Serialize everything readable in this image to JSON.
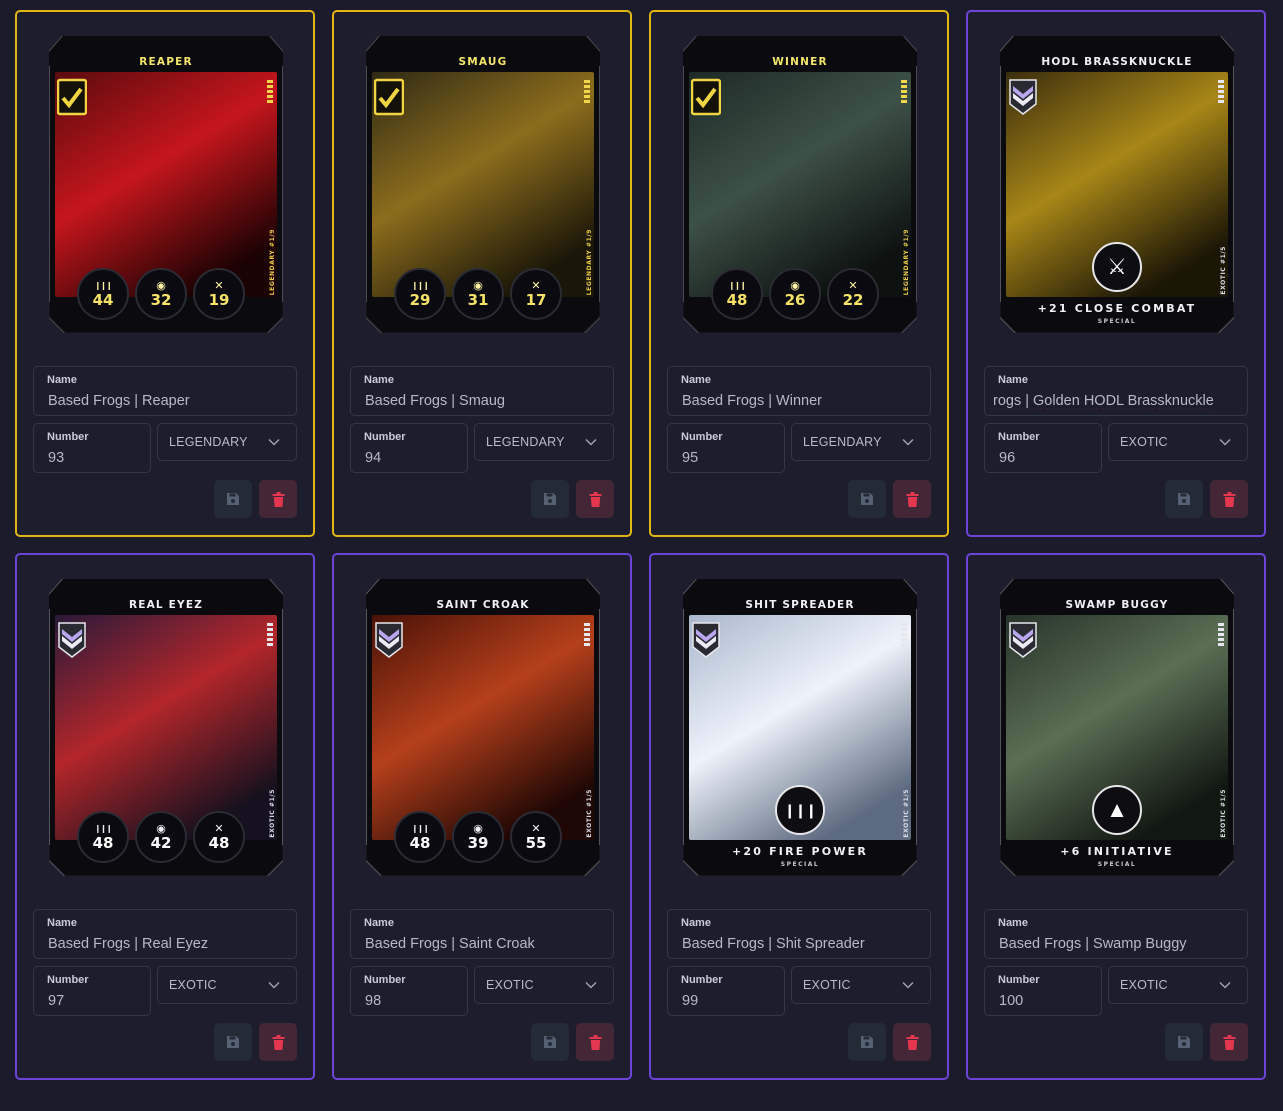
{
  "form": {
    "name_label": "Name",
    "number_label": "Number"
  },
  "colors": {
    "legendary": "#e2b613",
    "exotic": "#6c45d8",
    "save_icon": "#556273",
    "delete_icon": "#e5364f"
  },
  "icons": {
    "save": "floppy-disk-icon",
    "delete": "trash-icon",
    "dropdown": "chevron-down-icon"
  },
  "cards": [
    {
      "title": "REAPER",
      "rarity": "LEGENDARY",
      "name": "Based Frogs | Reaper",
      "number": "93",
      "side_label": "LEGENDARY #1/9",
      "stats": [
        {
          "icon": "ammo-icon",
          "value": "44"
        },
        {
          "icon": "eye-icon",
          "value": "32"
        },
        {
          "icon": "close-combat-icon",
          "value": "19"
        }
      ],
      "art_colors": [
        "#5a0b0e",
        "#c5161c",
        "#1b0203"
      ]
    },
    {
      "title": "SMAUG",
      "rarity": "LEGENDARY",
      "name": "Based Frogs | Smaug",
      "number": "94",
      "side_label": "LEGENDARY #1/9",
      "stats": [
        {
          "icon": "ammo-icon",
          "value": "29"
        },
        {
          "icon": "eye-icon",
          "value": "31"
        },
        {
          "icon": "close-combat-icon",
          "value": "17"
        }
      ],
      "art_colors": [
        "#2f2a15",
        "#8c6d1c",
        "#1a1608"
      ]
    },
    {
      "title": "WINNER",
      "rarity": "LEGENDARY",
      "name": "Based Frogs | Winner",
      "number": "95",
      "side_label": "LEGENDARY #1/9",
      "stats": [
        {
          "icon": "ammo-icon",
          "value": "48"
        },
        {
          "icon": "eye-icon",
          "value": "26"
        },
        {
          "icon": "close-combat-icon",
          "value": "22"
        }
      ],
      "art_colors": [
        "#1d2a26",
        "#3d5147",
        "#0d1211"
      ]
    },
    {
      "title": "HODL BRASSKNUCKLE",
      "rarity": "EXOTIC",
      "name": "Based Frogs | Golden HODL Brassknuckle",
      "name_visible": "rogs | Golden HODL Brassknuckle",
      "number": "96",
      "side_label": "EXOTIC #1/5",
      "special": {
        "icon": "crossed-swords-icon",
        "bonus": "+21 CLOSE COMBAT",
        "kind": "SPECIAL"
      },
      "art_colors": [
        "#3a2e0d",
        "#a88617",
        "#1b1606"
      ]
    },
    {
      "title": "REAL EYEZ",
      "rarity": "EXOTIC",
      "name": "Based Frogs | Real Eyez",
      "number": "97",
      "side_label": "EXOTIC #1/5",
      "stats": [
        {
          "icon": "ammo-icon",
          "value": "48"
        },
        {
          "icon": "eye-icon",
          "value": "42"
        },
        {
          "icon": "close-combat-icon",
          "value": "48"
        }
      ],
      "art_colors": [
        "#2a1a3a",
        "#b3262a",
        "#16111e"
      ]
    },
    {
      "title": "SAINT CROAK",
      "rarity": "EXOTIC",
      "name": "Based Frogs | Saint Croak",
      "number": "98",
      "side_label": "EXOTIC #1/5",
      "stats": [
        {
          "icon": "ammo-icon",
          "value": "48"
        },
        {
          "icon": "eye-icon",
          "value": "39"
        },
        {
          "icon": "close-combat-icon",
          "value": "55"
        }
      ],
      "art_colors": [
        "#4a1207",
        "#b5401b",
        "#1e0704"
      ]
    },
    {
      "title": "SHIT SPREADER",
      "rarity": "EXOTIC",
      "name": "Based Frogs | Shit Spreader",
      "number": "99",
      "side_label": "EXOTIC #1/5",
      "special": {
        "icon": "ammo-icon",
        "bonus": "+20 FIRE POWER",
        "kind": "SPECIAL"
      },
      "art_colors": [
        "#aab8cc",
        "#eef3fa",
        "#5d6b80"
      ]
    },
    {
      "title": "SWAMP BUGGY",
      "rarity": "EXOTIC",
      "name": "Based Frogs | Swamp Buggy",
      "number": "100",
      "side_label": "EXOTIC #1/5",
      "special": {
        "icon": "initiative-chevrons-icon",
        "bonus": "+6 INITIATIVE",
        "kind": "SPECIAL"
      },
      "art_colors": [
        "#27342a",
        "#5a6f54",
        "#111711"
      ]
    }
  ]
}
